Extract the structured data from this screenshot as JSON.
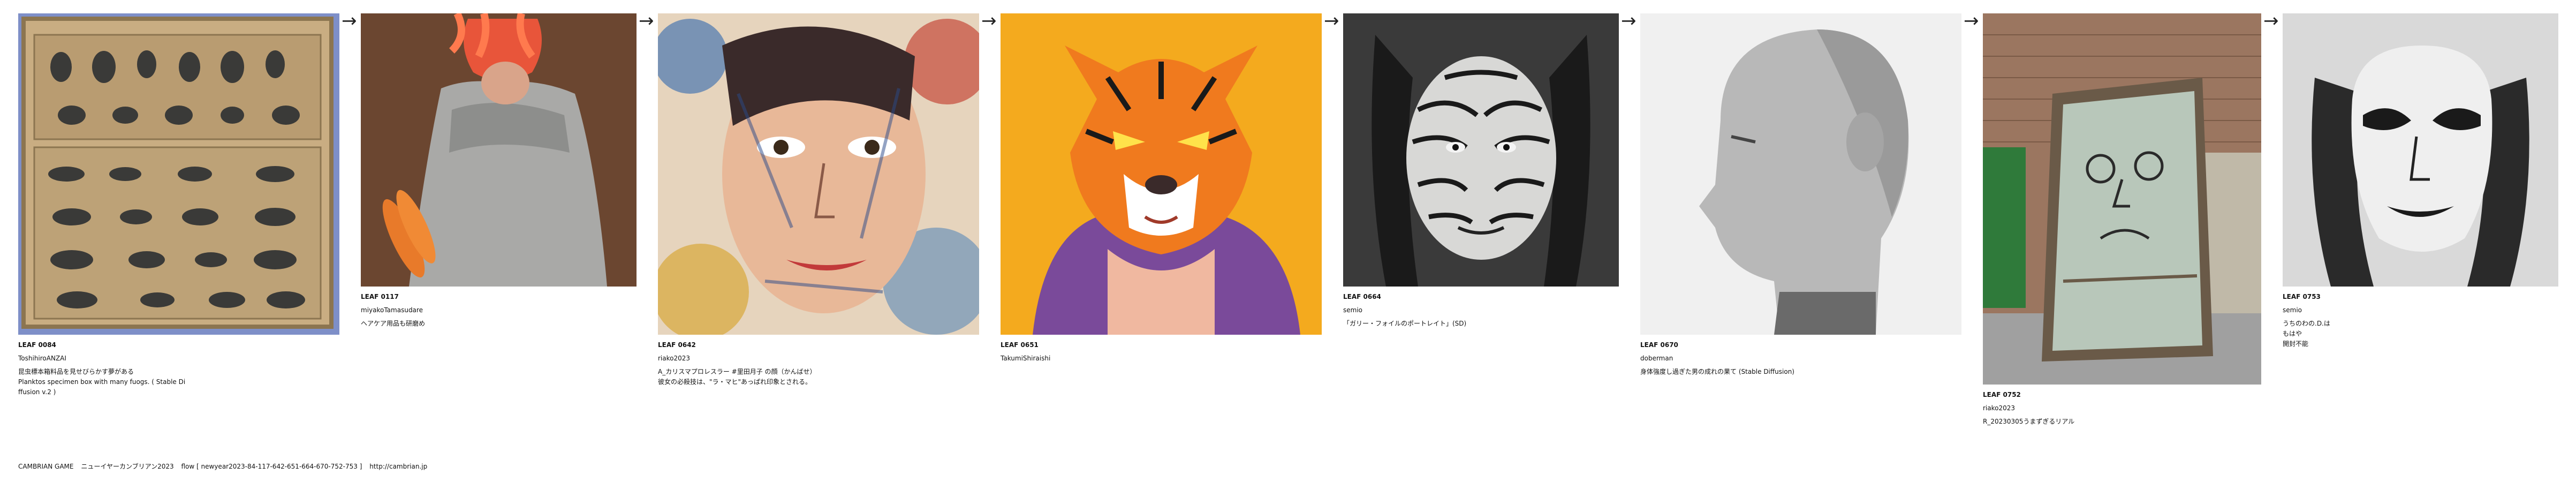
{
  "leaves": [
    {
      "id": "LEAF 0084",
      "author": "ToshihiroANZAI",
      "caption_lines": [
        "昆虫標本箱料品を見せびらかす夢がある",
        "Planktos specimen box with many fuogs. ( Stable Di",
        "ffusion v.2 )"
      ]
    },
    {
      "id": "LEAF 0117",
      "author": "miyakoTamasudare",
      "caption_lines": [
        "ヘアケア用品も研磨め"
      ]
    },
    {
      "id": "LEAF 0642",
      "author": "riako2023",
      "caption_lines": [
        "A_カリスマプロレスラー #里田月子 の顔（かんばせ）",
        "彼女の必殺技は、\"ラ・マヒ\"あっぱれ印象とされる。"
      ]
    },
    {
      "id": "LEAF 0651",
      "author": "TakumiShiraishi",
      "caption_lines": []
    },
    {
      "id": "LEAF 0664",
      "author": "semio",
      "caption_lines": [
        "「ガリー・フォイルのポートレイト」(SD)"
      ]
    },
    {
      "id": "LEAF 0670",
      "author": "doberman",
      "caption_lines": [
        "身体強度し過ぎた男の成れの果て (Stable Diffusion)"
      ]
    },
    {
      "id": "LEAF 0752",
      "author": "riako2023",
      "caption_lines": [
        "R_20230305うまずぎるリアル"
      ]
    },
    {
      "id": "LEAF 0753",
      "author": "semio",
      "caption_lines": [
        "うちのわの.D.は",
        "もはや",
        "開封不能"
      ]
    }
  ],
  "arrow": "→",
  "footer": {
    "brand": "CAMBRIAN GAME",
    "title": "ニューイヤーカンブリアン2023",
    "flow": "flow [ newyear2023-84-117-642-651-664-670-752-753 ]",
    "url": "http://cambrian.jp"
  },
  "image_subjects": [
    "specimen-box",
    "orange-haired-armored-figure",
    "painted-woman-face",
    "tiger-character",
    "striped-face-portrait",
    "bald-man-profile",
    "glass-panel-street",
    "mask-face"
  ]
}
